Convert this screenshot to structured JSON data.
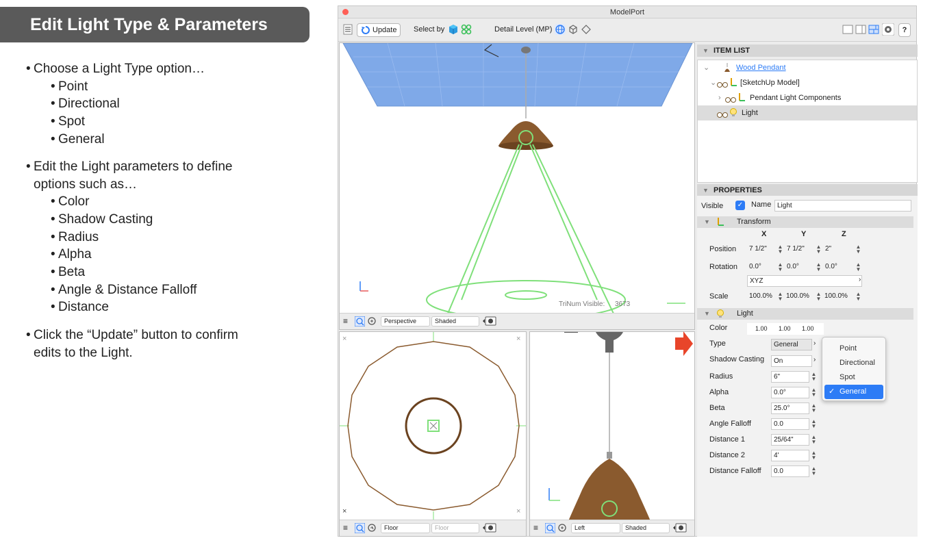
{
  "colors": {
    "banner": "#5a5a5a",
    "accent": "#2d7cf6",
    "arrow": "#e8452a",
    "light_green": "#7fe07a",
    "wood": "#8a5a2e"
  },
  "left_panel": {
    "title": "Edit Light Type & Parameters",
    "bullet1": "Choose a Light Type option…",
    "types": [
      "Point",
      "Directional",
      "Spot",
      "General"
    ],
    "bullet2a": "Edit the Light parameters to define",
    "bullet2b": "options such as…",
    "params": [
      "Color",
      "Shadow Casting",
      "Radius",
      "Alpha",
      "Beta",
      "Angle & Distance Falloff",
      "Distance"
    ],
    "bullet3a": "Click the “Update” button to confirm",
    "bullet3b": "edits to the Light."
  },
  "window": {
    "title": "ModelPort",
    "toolbar": {
      "update": "Update",
      "select_by": "Select by",
      "detail_level": "Detail Level (MP)"
    },
    "viewports": {
      "main": {
        "view": "Perspective",
        "mode": "Shaded",
        "trinum": "TriNum Visible:",
        "trinum_value": "3673"
      },
      "floor": {
        "view": "Floor",
        "mode": "Floor"
      },
      "left": {
        "view": "Left",
        "mode": "Shaded"
      }
    },
    "item_list": {
      "header": "ITEM LIST",
      "items": [
        "Wood Pendant",
        "[SketchUp Model]",
        "Pendant Light Components",
        "Light"
      ]
    },
    "properties": {
      "header": "PROPERTIES",
      "visible_label": "Visible",
      "name_label": "Name",
      "name_value": "Light",
      "transform_label": "Transform",
      "axes": [
        "X",
        "Y",
        "Z"
      ],
      "position_label": "Position",
      "position": [
        "7 1/2\"",
        "7 1/2\"",
        "2\""
      ],
      "rotation_label": "Rotation",
      "rotation": [
        "0.0°",
        "0.0°",
        "0.0°"
      ],
      "rotation_order": "XYZ",
      "scale_label": "Scale",
      "scale": [
        "100.0%",
        "100.0%",
        "100.0%"
      ],
      "light_label": "Light",
      "color_label": "Color",
      "color": [
        "1.00",
        "1.00",
        "1.00"
      ],
      "type_label": "Type",
      "type_value": "General",
      "shadow_label": "Shadow Casting",
      "shadow_value": "On",
      "radius_label": "Radius",
      "radius_value": "6\"",
      "alpha_label": "Alpha",
      "alpha_value": "0.0°",
      "beta_label": "Beta",
      "beta_value": "25.0°",
      "angle_falloff_label": "Angle Falloff",
      "angle_falloff_value": "0.0",
      "distance1_label": "Distance 1",
      "distance1_value": "25/64\"",
      "distance2_label": "Distance 2",
      "distance2_value": "4'",
      "distance_falloff_label": "Distance Falloff",
      "distance_falloff_value": "0.0"
    },
    "type_menu": {
      "options": [
        "Point",
        "Directional",
        "Spot",
        "General"
      ],
      "selected": "General"
    }
  }
}
